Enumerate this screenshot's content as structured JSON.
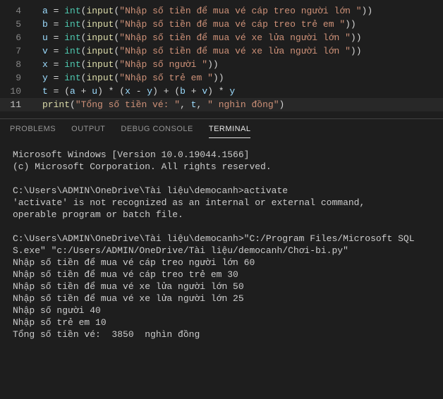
{
  "editor": {
    "lines": [
      {
        "num": "4",
        "active": false,
        "tokens": [
          {
            "cls": "tk-var",
            "t": "a"
          },
          {
            "cls": "tk-op",
            "t": " = "
          },
          {
            "cls": "tk-builtin",
            "t": "int"
          },
          {
            "cls": "tk-paren",
            "t": "("
          },
          {
            "cls": "tk-func",
            "t": "input"
          },
          {
            "cls": "tk-paren",
            "t": "("
          },
          {
            "cls": "tk-str",
            "t": "\"Nhập số tiền để mua vé cáp treo người lớn \""
          },
          {
            "cls": "tk-paren",
            "t": "))"
          }
        ]
      },
      {
        "num": "5",
        "active": false,
        "tokens": [
          {
            "cls": "tk-var",
            "t": "b"
          },
          {
            "cls": "tk-op",
            "t": " = "
          },
          {
            "cls": "tk-builtin",
            "t": "int"
          },
          {
            "cls": "tk-paren",
            "t": "("
          },
          {
            "cls": "tk-func",
            "t": "input"
          },
          {
            "cls": "tk-paren",
            "t": "("
          },
          {
            "cls": "tk-str",
            "t": "\"Nhập số tiền để mua vé cáp treo trẻ em \""
          },
          {
            "cls": "tk-paren",
            "t": "))"
          }
        ]
      },
      {
        "num": "6",
        "active": false,
        "tokens": [
          {
            "cls": "tk-var",
            "t": "u"
          },
          {
            "cls": "tk-op",
            "t": " = "
          },
          {
            "cls": "tk-builtin",
            "t": "int"
          },
          {
            "cls": "tk-paren",
            "t": "("
          },
          {
            "cls": "tk-func",
            "t": "input"
          },
          {
            "cls": "tk-paren",
            "t": "("
          },
          {
            "cls": "tk-str",
            "t": "\"Nhập số tiền để mua vé xe lửa người lớn \""
          },
          {
            "cls": "tk-paren",
            "t": "))"
          }
        ]
      },
      {
        "num": "7",
        "active": false,
        "tokens": [
          {
            "cls": "tk-var",
            "t": "v"
          },
          {
            "cls": "tk-op",
            "t": " = "
          },
          {
            "cls": "tk-builtin",
            "t": "int"
          },
          {
            "cls": "tk-paren",
            "t": "("
          },
          {
            "cls": "tk-func",
            "t": "input"
          },
          {
            "cls": "tk-paren",
            "t": "("
          },
          {
            "cls": "tk-str",
            "t": "\"Nhập số tiền để mua vé xe lửa người lớn \""
          },
          {
            "cls": "tk-paren",
            "t": "))"
          }
        ]
      },
      {
        "num": "8",
        "active": false,
        "tokens": [
          {
            "cls": "tk-var",
            "t": "x"
          },
          {
            "cls": "tk-op",
            "t": " = "
          },
          {
            "cls": "tk-builtin",
            "t": "int"
          },
          {
            "cls": "tk-paren",
            "t": "("
          },
          {
            "cls": "tk-func",
            "t": "input"
          },
          {
            "cls": "tk-paren",
            "t": "("
          },
          {
            "cls": "tk-str",
            "t": "\"Nhập số người \""
          },
          {
            "cls": "tk-paren",
            "t": "))"
          }
        ]
      },
      {
        "num": "9",
        "active": false,
        "tokens": [
          {
            "cls": "tk-var",
            "t": "y"
          },
          {
            "cls": "tk-op",
            "t": " = "
          },
          {
            "cls": "tk-builtin",
            "t": "int"
          },
          {
            "cls": "tk-paren",
            "t": "("
          },
          {
            "cls": "tk-func",
            "t": "input"
          },
          {
            "cls": "tk-paren",
            "t": "("
          },
          {
            "cls": "tk-str",
            "t": "\"Nhập số trẻ em \""
          },
          {
            "cls": "tk-paren",
            "t": "))"
          }
        ]
      },
      {
        "num": "10",
        "active": false,
        "tokens": [
          {
            "cls": "tk-var",
            "t": "t"
          },
          {
            "cls": "tk-op",
            "t": " = ("
          },
          {
            "cls": "tk-var",
            "t": "a"
          },
          {
            "cls": "tk-op",
            "t": " + "
          },
          {
            "cls": "tk-var",
            "t": "u"
          },
          {
            "cls": "tk-op",
            "t": ") * ("
          },
          {
            "cls": "tk-var",
            "t": "x"
          },
          {
            "cls": "tk-op",
            "t": " - "
          },
          {
            "cls": "tk-var",
            "t": "y"
          },
          {
            "cls": "tk-op",
            "t": ") + ("
          },
          {
            "cls": "tk-var",
            "t": "b"
          },
          {
            "cls": "tk-op",
            "t": " + "
          },
          {
            "cls": "tk-var",
            "t": "v"
          },
          {
            "cls": "tk-op",
            "t": ") * "
          },
          {
            "cls": "tk-var",
            "t": "y"
          }
        ]
      },
      {
        "num": "11",
        "active": true,
        "tokens": [
          {
            "cls": "tk-func",
            "t": "print"
          },
          {
            "cls": "tk-paren",
            "t": "("
          },
          {
            "cls": "tk-str",
            "t": "\"Tổng số tiền vé: \""
          },
          {
            "cls": "tk-op",
            "t": ", "
          },
          {
            "cls": "tk-var",
            "t": "t"
          },
          {
            "cls": "tk-op",
            "t": ", "
          },
          {
            "cls": "tk-str",
            "t": "\" nghìn đồng\""
          },
          {
            "cls": "tk-paren",
            "t": ")"
          }
        ]
      }
    ]
  },
  "panel": {
    "tabs": [
      {
        "label": "PROBLEMS",
        "active": false
      },
      {
        "label": "OUTPUT",
        "active": false
      },
      {
        "label": "DEBUG CONSOLE",
        "active": false
      },
      {
        "label": "TERMINAL",
        "active": true
      }
    ]
  },
  "terminal": {
    "lines": [
      "Microsoft Windows [Version 10.0.19044.1566]",
      "(c) Microsoft Corporation. All rights reserved.",
      "",
      "C:\\Users\\ADMIN\\OneDrive\\Tài liệu\\democanh>activate",
      "'activate' is not recognized as an internal or external command,",
      "operable program or batch file.",
      "",
      "C:\\Users\\ADMIN\\OneDrive\\Tài liệu\\democanh>\"C:/Program Files/Microsoft SQL S.exe\" \"c:/Users/ADMIN/OneDrive/Tài liệu/democanh/Chơi-bi.py\"",
      "Nhập số tiền để mua vé cáp treo người lớn 60",
      "Nhập số tiền để mua vé cáp treo trẻ em 30",
      "Nhập số tiền để mua vé xe lửa người lớn 50",
      "Nhập số tiền để mua vé xe lửa người lớn 25",
      "Nhập số người 40",
      "Nhập số trẻ em 10",
      "Tổng số tiền vé:  3850  nghìn đồng"
    ]
  }
}
